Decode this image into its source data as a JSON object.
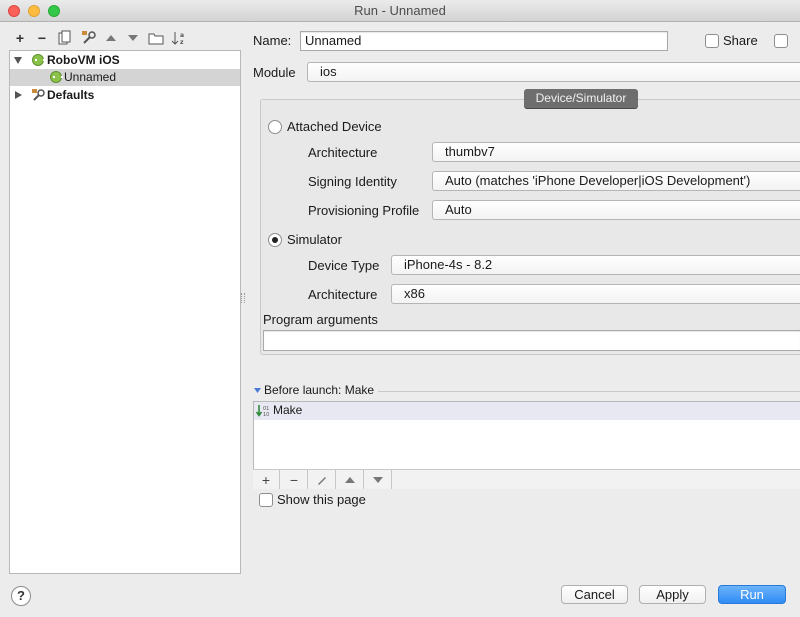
{
  "window": {
    "title": "Run - Unnamed"
  },
  "toolbar": {
    "add_label": "+",
    "remove_label": "−"
  },
  "tree": {
    "group_label": "RoboVM iOS",
    "item_label": "Unnamed",
    "defaults_label": "Defaults"
  },
  "form": {
    "name_label": "Name:",
    "name_value": "Unnamed",
    "share_label": "Share",
    "module_label": "Module",
    "module_value": "ios"
  },
  "device_panel": {
    "title": "Device/Simulator",
    "attached_label": "Attached Device",
    "attached_selected": false,
    "architecture_label": "Architecture",
    "architecture_value": "thumbv7",
    "signing_label": "Signing Identity",
    "signing_value": "Auto (matches 'iPhone Developer|iOS Development')",
    "provisioning_label": "Provisioning Profile",
    "provisioning_value": "Auto",
    "simulator_label": "Simulator",
    "simulator_selected": true,
    "device_type_label": "Device Type",
    "device_type_value": "iPhone-4s - 8.2",
    "sim_architecture_label": "Architecture",
    "sim_architecture_value": "x86"
  },
  "program_args": {
    "label": "Program arguments",
    "value": ""
  },
  "before_launch": {
    "header": "Before launch: Make",
    "items": [
      "Make"
    ]
  },
  "show_page": {
    "label": "Show this page",
    "checked": false
  },
  "buttons": {
    "help": "?",
    "cancel": "Cancel",
    "apply": "Apply",
    "run": "Run"
  },
  "colors": {
    "accent": "#2f8cf5",
    "selection": "#d4d4d4",
    "robovm_green": "#8bc34a"
  }
}
